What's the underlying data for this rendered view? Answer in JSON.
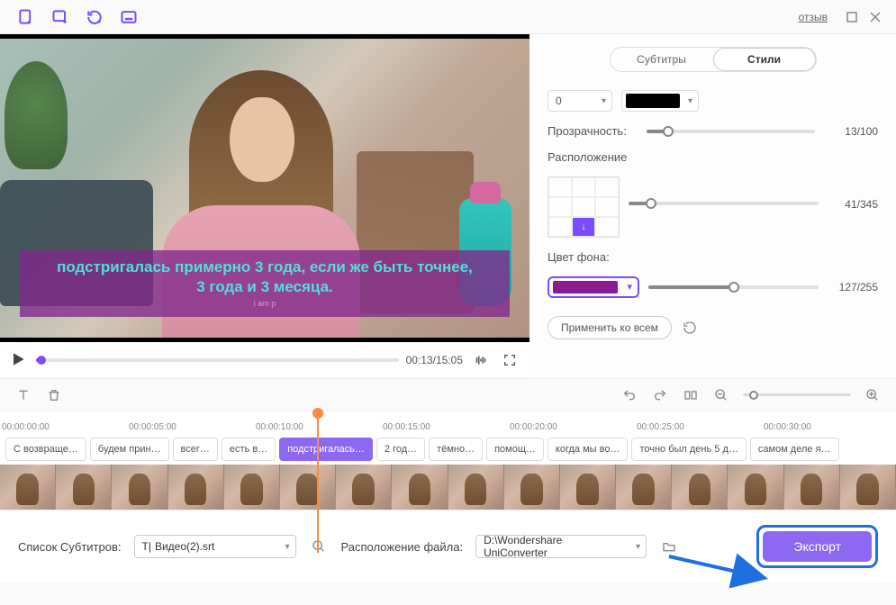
{
  "header": {
    "review_link": "отзыв"
  },
  "video": {
    "subtitle_line1": "подстригалась примерно 3 года, если же быть точнее,",
    "subtitle_line2": "3 года и 3 месяца.",
    "watermark": "i am p",
    "time": "00:13/15:05"
  },
  "tabs": {
    "subtitles": "Субтитры",
    "styles": "Стили"
  },
  "controls": {
    "select0": "0",
    "opacity_label": "Прозрачность:",
    "opacity_value": "13/100",
    "position_label": "Расположение",
    "position_value": "41/345",
    "bgcolor_label": "Цвет фона:",
    "bgcolor_value": "127/255",
    "apply_all": "Применить ко всем"
  },
  "ruler": [
    "00:00:00:00",
    "00:00:05:00",
    "00:00:10:00",
    "00:00:15:00",
    "00:00:20:00",
    "00:00:25:00",
    "00:00:30:00"
  ],
  "clips": [
    {
      "label": "С возвраще…",
      "active": false
    },
    {
      "label": "будем прин…",
      "active": false
    },
    {
      "label": "всег…",
      "active": false
    },
    {
      "label": "есть в…",
      "active": false
    },
    {
      "label": "подстригалась…",
      "active": true
    },
    {
      "label": "2 год…",
      "active": false
    },
    {
      "label": "тёмно…",
      "active": false
    },
    {
      "label": "помощ…",
      "active": false
    },
    {
      "label": "когда мы во…",
      "active": false
    },
    {
      "label": "точно был день 5 д…",
      "active": false
    },
    {
      "label": "самом деле я…",
      "active": false
    }
  ],
  "bottom": {
    "list_label": "Список Субтитров:",
    "srt_file": "Видео(2).srt",
    "path_label": "Расположение файла:",
    "path_value": "D:\\Wondershare UniConverter",
    "export": "Экспорт"
  }
}
